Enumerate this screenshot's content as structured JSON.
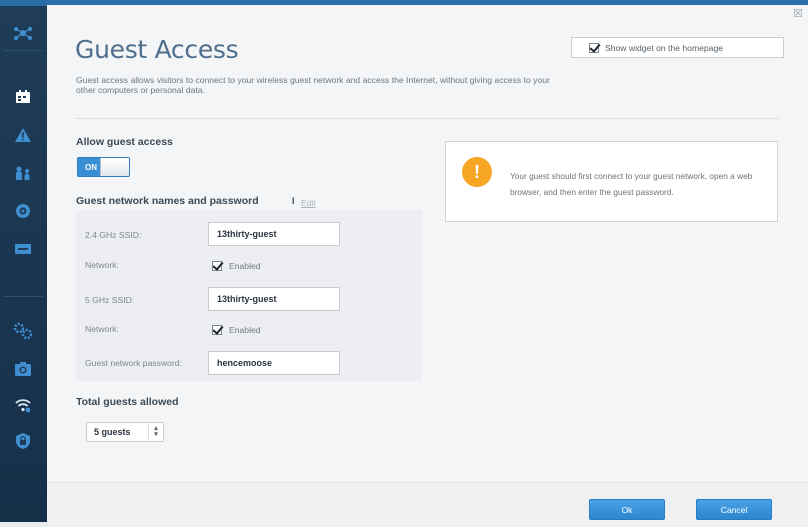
{
  "sidebar": {
    "items": [
      {
        "icon": "network-map-icon"
      },
      {
        "icon": "guest-access-icon"
      },
      {
        "icon": "troubleshooting-icon"
      },
      {
        "icon": "parental-controls-icon"
      },
      {
        "icon": "media-prioritization-icon"
      },
      {
        "icon": "external-storage-icon"
      },
      {
        "icon": "connectivity-icon"
      },
      {
        "icon": "security-icon"
      },
      {
        "icon": "wireless-icon"
      },
      {
        "icon": "router-security-icon"
      }
    ]
  },
  "page": {
    "close_glyph": "☒",
    "title": "Guest Access",
    "description": "Guest access allows visitors to connect to your wireless guest network and access the Internet, without giving access to your other computers or personal data.",
    "widget_checkbox_label": "Show widget on the homepage",
    "widget_checked": true
  },
  "allow": {
    "heading": "Allow guest access",
    "toggle_label": "ON",
    "enabled": true
  },
  "network": {
    "heading": "Guest network names and password",
    "separator": "I",
    "edit_link": "Edit",
    "ssid24_label": "2.4 GHz SSID:",
    "ssid24_value": "13thirty-guest",
    "network_label": "Network:",
    "net24_enabled_label": "Enabled",
    "ssid5_label": "5 GHz SSID:",
    "ssid5_value": "13thirty-guest",
    "net5_enabled_label": "Enabled",
    "password_label": "Guest network password:",
    "password_value": "hencemoose"
  },
  "guests": {
    "heading": "Total guests allowed",
    "selected": "5 guests",
    "arrows": "▲▼"
  },
  "info": {
    "icon_glyph": "!",
    "text": "Your guest should first connect to your guest network, open a web browser, and then enter the guest password."
  },
  "footer": {
    "ok_label": "Ok",
    "cancel_label": "Cancel"
  },
  "colors": {
    "accent": "#3a8fd4",
    "sidebar": "#1f3c58",
    "warning": "#f5a623"
  }
}
